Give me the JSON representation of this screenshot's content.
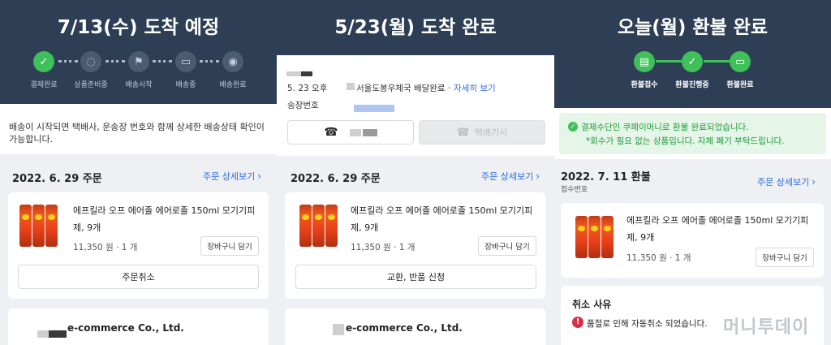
{
  "panel1": {
    "title": "7/13(수) 도착 예정",
    "steps": [
      {
        "label": "결제완료",
        "icon": "check-icon",
        "glyph": "✓",
        "active": true
      },
      {
        "label": "상품준비중",
        "icon": "loading-icon",
        "glyph": "◌",
        "active": false
      },
      {
        "label": "배송시작",
        "icon": "flag-icon",
        "glyph": "⚑",
        "active": false
      },
      {
        "label": "배송중",
        "icon": "truck-icon",
        "glyph": "▭",
        "active": false
      },
      {
        "label": "배송완료",
        "icon": "location-pin-icon",
        "glyph": "◉",
        "active": false
      }
    ],
    "notice": "배송이 시작되면 택배사, 운송장 번호와 함께 상세한 배송상태 확인이 가능합니다.",
    "order_date": "2022. 6. 29 주문",
    "order_detail_link": "주문 상세보기",
    "product_name": "에프킬라 오프 에어졸 에어로졸 150ml 모기기피제, 9개",
    "price": "11,350 원 · 1 개",
    "cart_button": "장바구니 담기",
    "action_button": "주문취소",
    "company": "e-commerce Co., Ltd."
  },
  "panel2": {
    "title": "5/23(월) 도착 완료",
    "delivery_time": "5. 23 오후",
    "delivery_status": "서울도봉우체국 배달완료 ·",
    "detail_link": "자세히 보기",
    "tracking_label": "송장번호",
    "courier_button": "택배기사",
    "order_date": "2022. 6. 29 주문",
    "order_detail_link": "주문 상세보기",
    "product_name": "에프킬라 오프 에어졸 에어로졸 150ml 모기기피제, 9개",
    "price": "11,350 원 · 1 개",
    "cart_button": "장바구니 담기",
    "action_button": "교환, 반품 신청",
    "company": "e-commerce Co., Ltd."
  },
  "panel3": {
    "title": "오늘(월) 환불 완료",
    "steps": [
      {
        "label": "환불접수",
        "icon": "document-icon",
        "glyph": "▤",
        "active": true
      },
      {
        "label": "환불진행중",
        "icon": "check-icon",
        "glyph": "✓",
        "active": true
      },
      {
        "label": "환불완료",
        "icon": "card-icon",
        "glyph": "▭",
        "active": true
      }
    ],
    "notice_line1": "결제수단인 쿠페이머니로 환불 완료되었습니다.",
    "notice_line2": "*회수가 필요 없는 상품입니다. 자체 폐기 부탁드립니다.",
    "refund_date": "2022. 7. 11 환불",
    "receipt_label": "접수번호",
    "order_detail_link": "주문 상세보기",
    "product_name": "에프킬라 오프 에어졸 에어로졸 150ml 모기기피제, 9개",
    "price": "11,350 원 · 1 개",
    "cart_button": "장바구니 담기",
    "cancel_reason_title": "취소 사유",
    "cancel_reason": "품절로 인해 자동취소 되었습니다.",
    "watermark": "머니투데이"
  },
  "colors": {
    "header": "#2d3e55",
    "active_step": "#3fc05a",
    "link": "#2d6be6",
    "notice_green_bg": "#e5f5e8",
    "notice_green_text": "#1f9a3a",
    "warning_red": "#d9304a"
  }
}
